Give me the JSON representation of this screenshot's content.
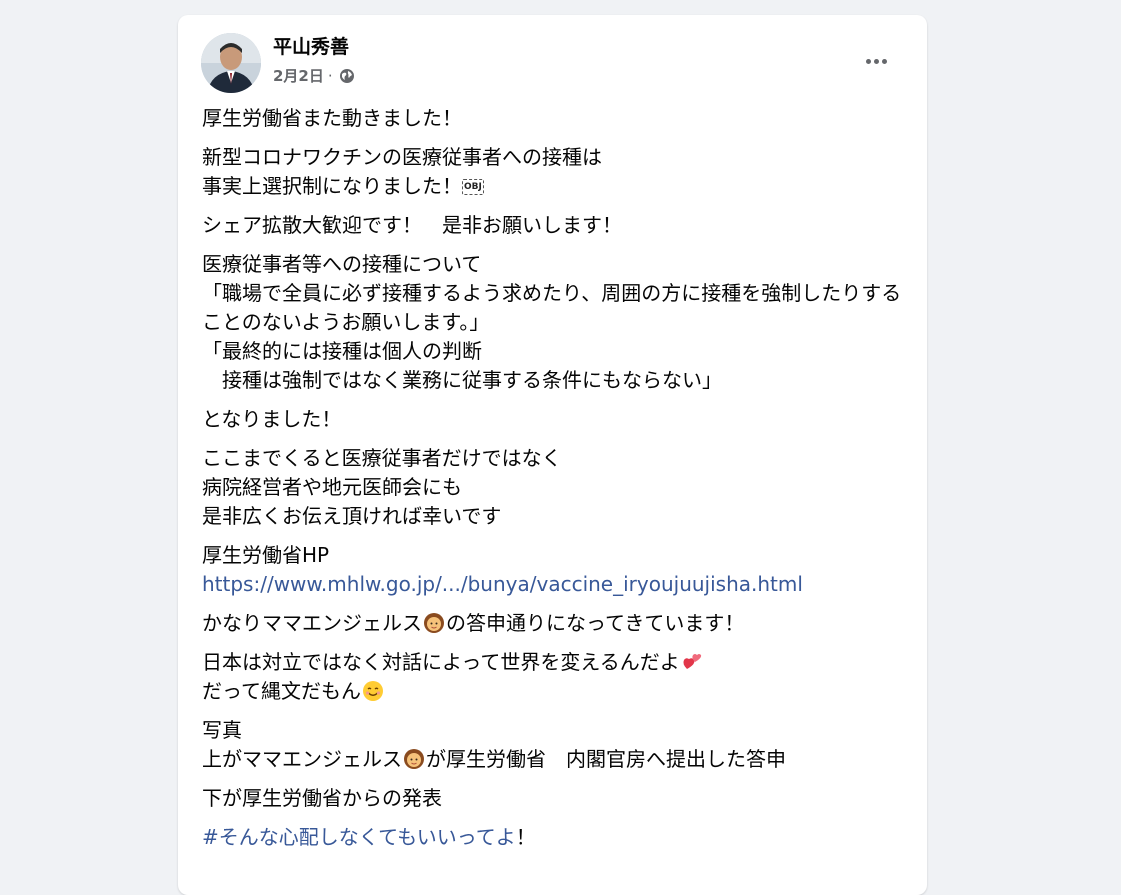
{
  "post": {
    "author": "平山秀善",
    "date": "2月2日",
    "separator": "·",
    "privacy_icon": "globe-icon",
    "more_icon": "more-options-icon"
  },
  "content": {
    "p1": "厚生労働省また動きました！",
    "p2_l1": "新型コロナワクチンの医療従事者への接種は",
    "p2_l2": "事実上選択制になりました！",
    "p2_obj": "OBJ",
    "p3": "シェア拡散大歓迎です！　是非お願いします！",
    "p4_l1": "医療従事者等への接種について",
    "p4_l2": "「職場で全員に必ず接種するよう求めたり、周囲の方に接種を強制したりすることのないようお願いします。」",
    "p4_l3": "「最終的には接種は個人の判断",
    "p4_l4": "　接種は強制ではなく業務に従事する条件にもならない」",
    "p5": "となりました！",
    "p6_l1": "ここまでくると医療従事者だけではなく",
    "p6_l2": "病院経営者や地元医師会にも",
    "p6_l3": "是非広くお伝え頂ければ幸いです",
    "p7_l1": "厚生労働省HP",
    "p7_link": "https://www.mhlw.go.jp/.../bunya/vaccine_iryoujuujisha.html",
    "p8_a": "かなりママエンジェルス",
    "p8_b": "の答申通りになってきています！",
    "p9_l1": "日本は対立ではなく対話によって世界を変えるんだよ",
    "p9_l2": "だって縄文だもん",
    "p10_l1": "写真",
    "p10_l2a": "上がママエンジェルス",
    "p10_l2b": "が厚生労働省　内閣官房へ提出した答申",
    "p11": "下が厚生労働省からの発表",
    "p12_tag": "#そんな心配しなくてもいいってよ",
    "p12_end": "！"
  }
}
